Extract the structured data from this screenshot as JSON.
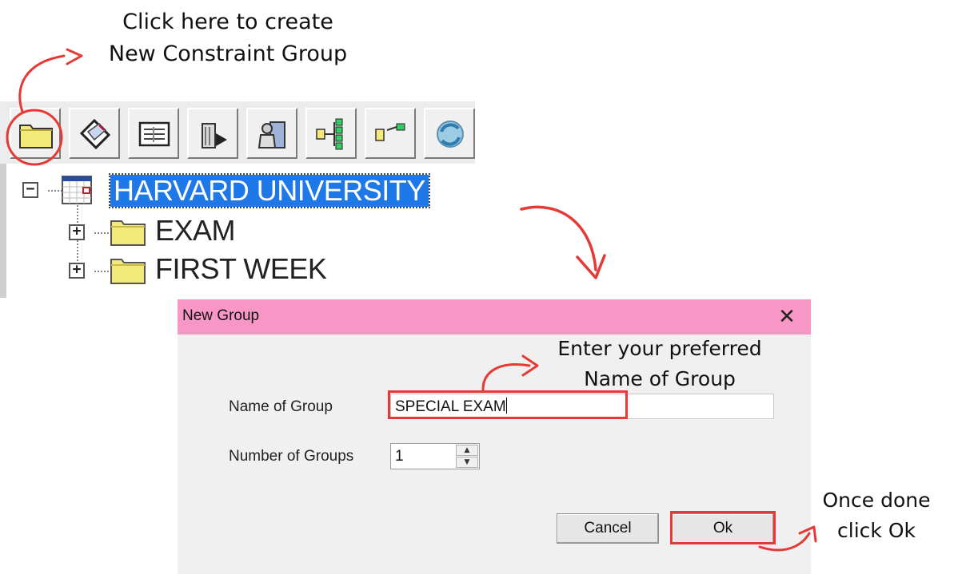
{
  "annotations": {
    "top_line1": "Click here to create",
    "top_line2": "New Constraint Group",
    "mid_line1": "Enter your preferred",
    "mid_line2": "Name of Group",
    "right_line1": "Once done",
    "right_line2": "click Ok"
  },
  "tree": {
    "root_label": "HARVARD UNIVERSITY",
    "children": [
      {
        "label": "EXAM",
        "expander": "+"
      },
      {
        "label": "FIRST WEEK",
        "expander": "+"
      }
    ],
    "root_expander": "−"
  },
  "toolbar": {
    "icons": [
      "folder-icon",
      "card-icon",
      "list-icon",
      "trash-icon",
      "user-delete-icon",
      "flow-icon",
      "link-icon",
      "refresh-icon"
    ]
  },
  "dialog": {
    "title": "New Group",
    "close_label": "✕",
    "name_label": "Name of Group",
    "name_value": "SPECIAL EXAM",
    "count_label": "Number of Groups",
    "count_value": "1",
    "cancel_label": "Cancel",
    "ok_label": "Ok"
  },
  "colors": {
    "highlight": "#e53935",
    "title_bar": "#f897c6",
    "selection": "#1e78e8"
  }
}
